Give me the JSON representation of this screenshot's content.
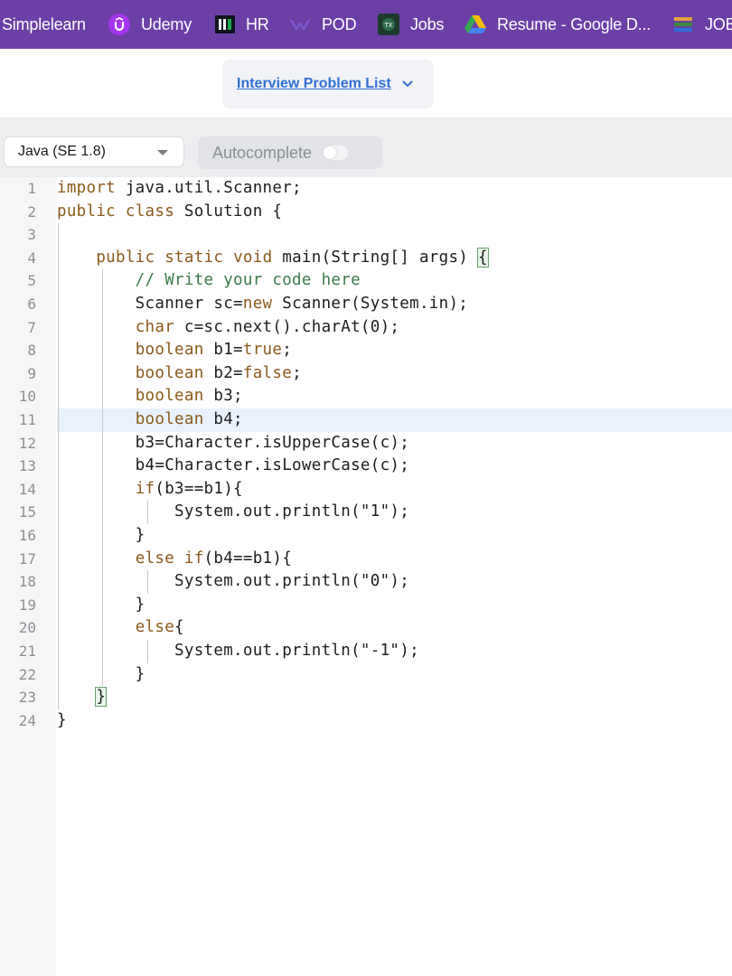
{
  "bookmarks": [
    {
      "label": "Simplelearn",
      "icon": "none"
    },
    {
      "label": "Udemy",
      "icon": "udemy-icon"
    },
    {
      "label": "HR",
      "icon": "hackerrank-icon"
    },
    {
      "label": "POD",
      "icon": "pod-icon"
    },
    {
      "label": "Jobs",
      "icon": "jobs-icon"
    },
    {
      "label": "Resume - Google D...",
      "icon": "google-drive-icon"
    },
    {
      "label": "JOB",
      "icon": "folder-stack-icon"
    }
  ],
  "problem_list": {
    "label": "Interview Problem List"
  },
  "toolbar": {
    "language": "Java (SE 1.8)",
    "autocomplete_label": "Autocomplete",
    "autocomplete_on": false
  },
  "editor": {
    "line_numbers": [
      "1",
      "2",
      "3",
      "4",
      "5",
      "6",
      "7",
      "8",
      "9",
      "10",
      "11",
      "12",
      "13",
      "14",
      "15",
      "16",
      "17",
      "18",
      "19",
      "20",
      "21",
      "22",
      "23",
      "24"
    ],
    "lines": [
      "import java.util.Scanner;",
      "public class Solution {",
      "",
      "    public static void main(String[] args) {",
      "        // Write your code here",
      "        Scanner sc=new Scanner(System.in);",
      "        char c=sc.next().charAt(0);",
      "        boolean b1=true;",
      "        boolean b2=false;",
      "        boolean b3;",
      "        boolean b4;",
      "        b3=Character.isUpperCase(c);",
      "        b4=Character.isLowerCase(c);",
      "        if(b3==b1){",
      "            System.out.println(\"1\");",
      "        }",
      "        else if(b4==b1){",
      "            System.out.println(\"0\");",
      "        }",
      "        else{",
      "            System.out.println(\"-1\");",
      "        }",
      "    }",
      "}"
    ],
    "highlighted_line": 11
  },
  "colors": {
    "bookmark_bar": "#6c3fa6",
    "link_blue": "#2f6fd6",
    "keyword": "#8a5a1a",
    "comment": "#3a7a4a",
    "highlight": "#e8f1fc"
  }
}
